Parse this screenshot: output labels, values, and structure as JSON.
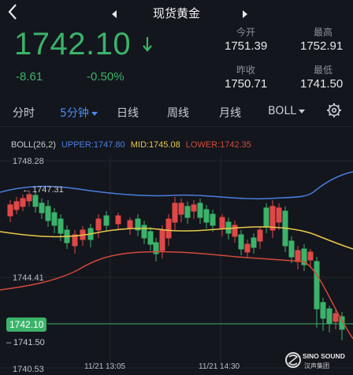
{
  "header": {
    "title": "现货黄金"
  },
  "quote": {
    "price": "1742.10",
    "change": "-8.61",
    "change_pct": "-0.50%",
    "open_label": "今开",
    "open": "1751.39",
    "high_label": "最高",
    "high": "1752.91",
    "prev_close_label": "昨收",
    "prev_close": "1750.71",
    "low_label": "最低",
    "low": "1741.50"
  },
  "tabs": [
    {
      "label": "分时"
    },
    {
      "label": "5分钟"
    },
    {
      "label": "日线"
    },
    {
      "label": "周线"
    },
    {
      "label": "月线"
    },
    {
      "label": "BOLL"
    }
  ],
  "indicator": {
    "name": "BOLL(26,2)",
    "upper": "UPPER:1747.80",
    "mid": "MID:1745.08",
    "lower": "LOWER:1742.35"
  },
  "chart": {
    "y_top": "1748.28",
    "y_mid": "1744.41",
    "y_bottom": "1740.53",
    "high_marker": "1747.31",
    "low_marker": "1741.50",
    "last_price": "1742.10",
    "time_1": "11/21 13:05",
    "time_2": "11/21 14:30"
  },
  "colors": {
    "up": "#e04848",
    "down": "#3bb36a",
    "upper": "#4a7fe0",
    "mid": "#e8c94a",
    "lower": "#d14a3a"
  },
  "watermark": {
    "brand": "SINO SOUND",
    "sub": "汉声集团"
  }
}
